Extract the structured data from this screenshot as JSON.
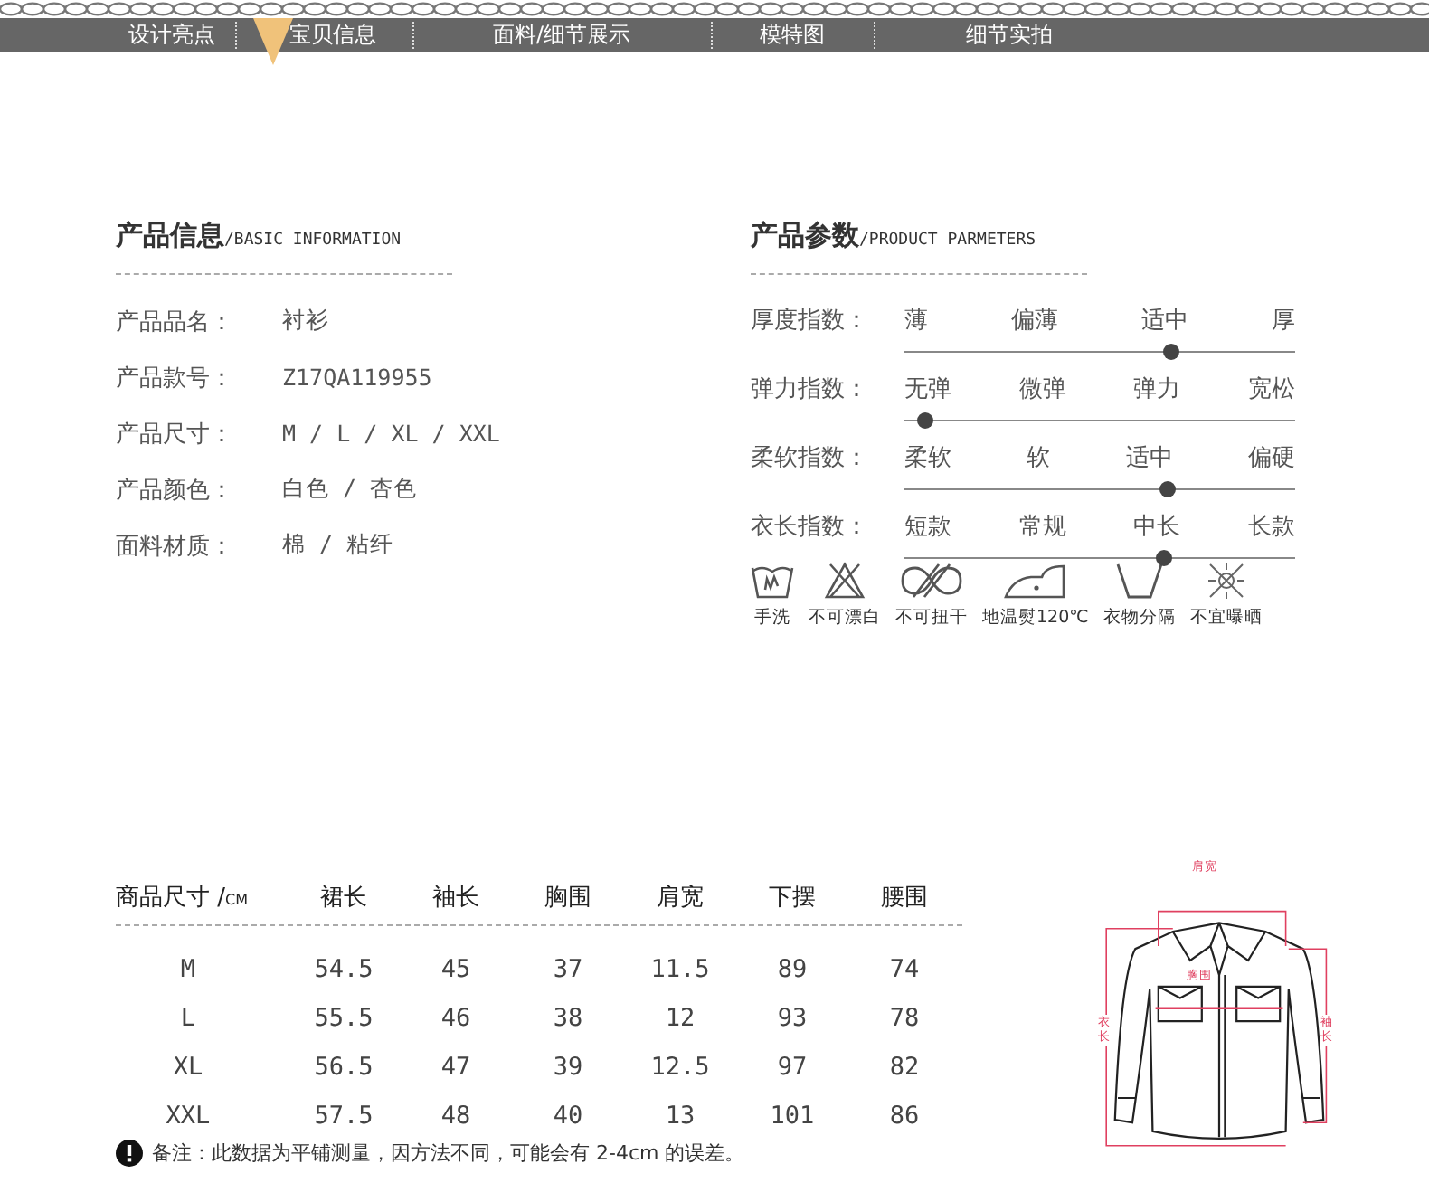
{
  "nav": {
    "tabs": [
      {
        "label": "设计亮点",
        "selected": false
      },
      {
        "label": "宝贝信息",
        "selected": true
      },
      {
        "label": "面料/细节展示",
        "selected": false
      },
      {
        "label": "模特图",
        "selected": false
      },
      {
        "label": "细节实拍",
        "selected": false
      }
    ]
  },
  "basic_info": {
    "title": "产品信息",
    "subtitle": "/BASIC INFORMATION",
    "rows": [
      {
        "label": "产品品名：",
        "value": "衬衫"
      },
      {
        "label": "产品款号：",
        "value": "Z17QA119955"
      },
      {
        "label": "产品尺寸：",
        "value": "M / L / XL / XXL"
      },
      {
        "label": "产品颜色：",
        "value": "白色 / 杏色"
      },
      {
        "label": "面料材质：",
        "value": "棉 / 粘纤"
      }
    ]
  },
  "parameters": {
    "title": "产品参数",
    "subtitle": "/PRODUCT PARMETERS",
    "scales": [
      {
        "label": "厚度指数：",
        "options": [
          "薄",
          "偏薄",
          "适中",
          "厚"
        ],
        "level": 0.68
      },
      {
        "label": "弹力指数：",
        "options": [
          "无弹",
          "微弹",
          "弹力",
          "宽松"
        ],
        "level": 0.05
      },
      {
        "label": "柔软指数：",
        "options": [
          "柔软",
          "软",
          "适中",
          "偏硬"
        ],
        "level": 0.67
      },
      {
        "label": "衣长指数：",
        "options": [
          "短款",
          "常规",
          "中长",
          "长款"
        ],
        "level": 0.66
      }
    ],
    "care": [
      {
        "kind": "hand-wash",
        "label": "手洗"
      },
      {
        "kind": "no-bleach",
        "label": "不可漂白"
      },
      {
        "kind": "no-wring",
        "label": "不可扭干"
      },
      {
        "kind": "iron",
        "label": "地温熨120℃"
      },
      {
        "kind": "separate",
        "label": "衣物分隔"
      },
      {
        "kind": "no-sun",
        "label": "不宜曝晒"
      }
    ]
  },
  "size_table": {
    "unit": "CM",
    "columns": [
      "商品尺寸 /",
      "裙长",
      "袖长",
      "胸围",
      "肩宽",
      "下摆",
      "腰围"
    ],
    "rows": [
      [
        "M",
        "54.5",
        "45",
        "37",
        "11.5",
        "89",
        "74"
      ],
      [
        "L",
        "55.5",
        "46",
        "38",
        "12",
        "93",
        "78"
      ],
      [
        "XL",
        "56.5",
        "47",
        "39",
        "12.5",
        "97",
        "82"
      ],
      [
        "XXL",
        "57.5",
        "48",
        "40",
        "13",
        "101",
        "86"
      ]
    ],
    "note": "备注：此数据为平铺测量，因方法不同，可能会有 2-4cm 的误差。"
  },
  "diagram": {
    "shoulder": "肩宽",
    "chest": "胸围",
    "length": "衣长",
    "sleeve": "袖长"
  }
}
